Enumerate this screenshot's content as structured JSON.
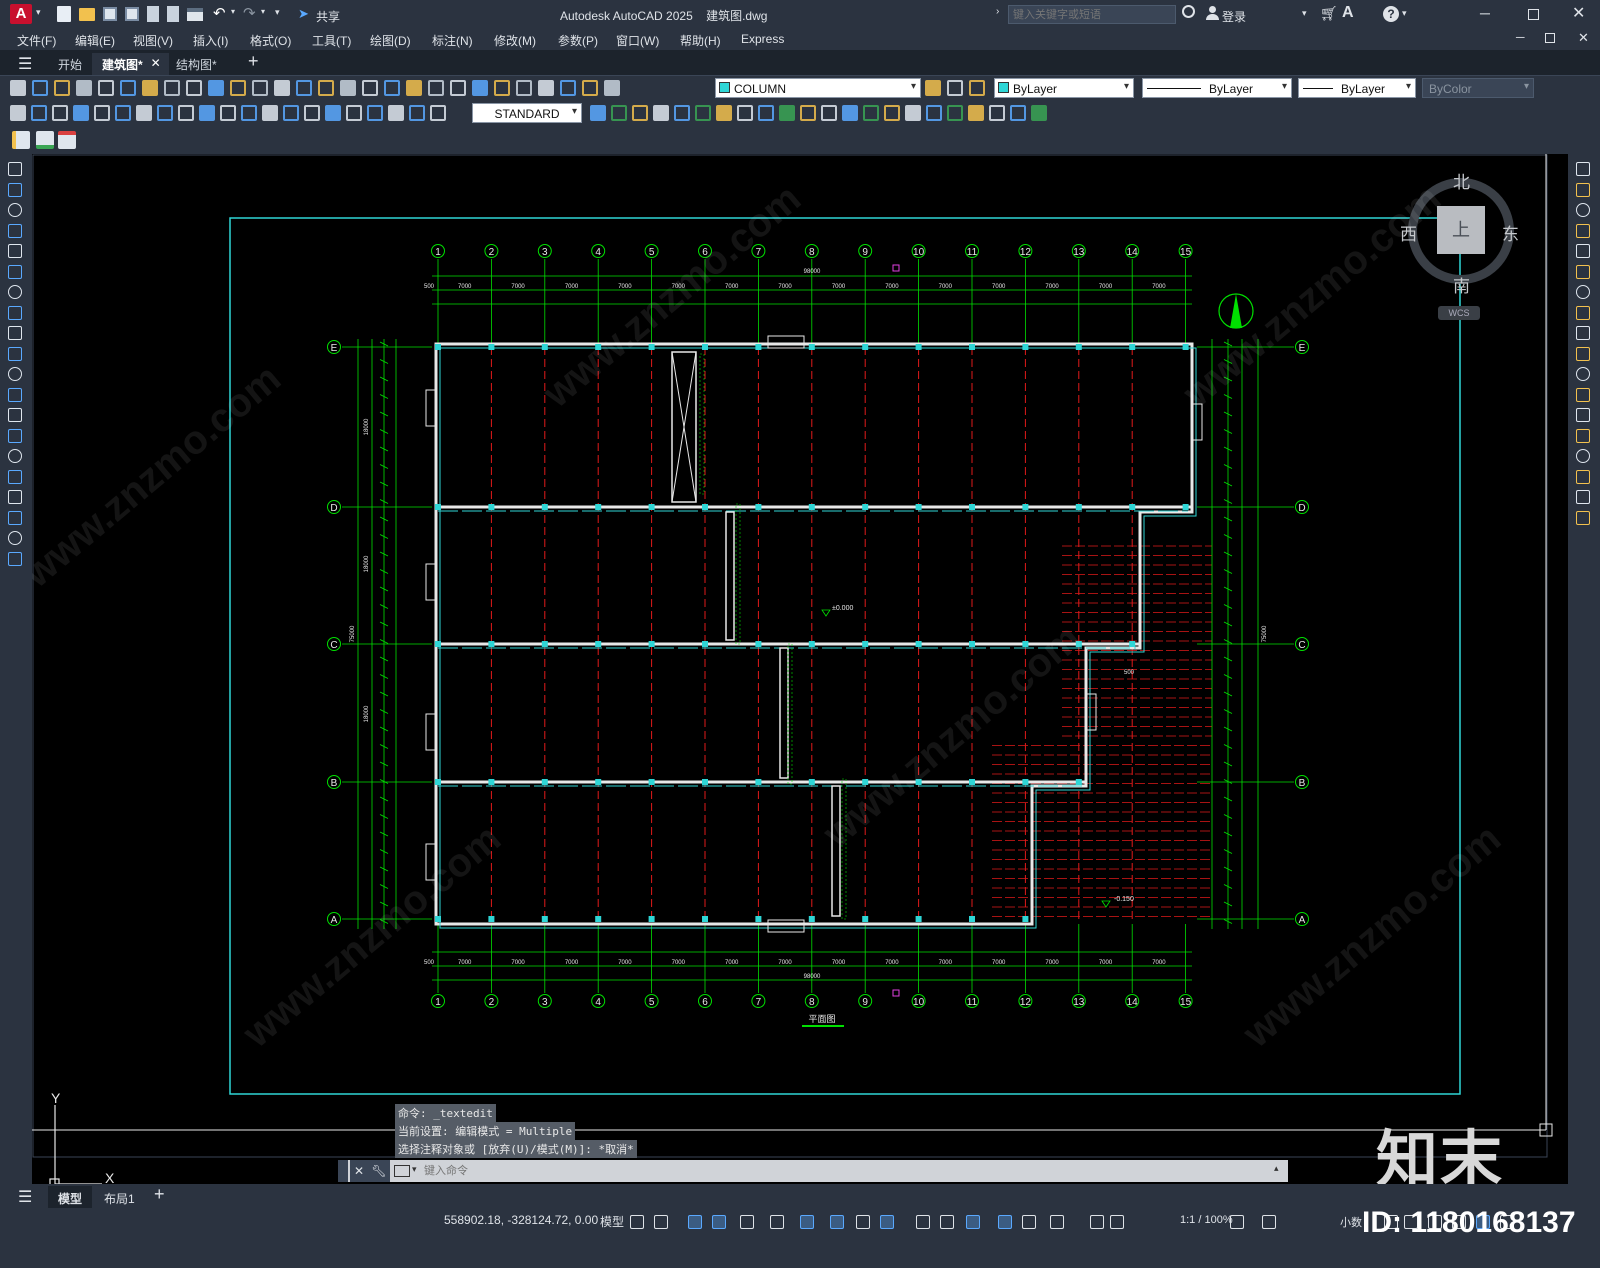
{
  "app": {
    "title": "Autodesk AutoCAD 2025    建筑图.dwg",
    "logo_letter": "A",
    "share_label": "共享",
    "search_placeholder": "键入关键字或短语",
    "login_label": "登录"
  },
  "menu": [
    "文件(F)",
    "编辑(E)",
    "视图(V)",
    "插入(I)",
    "格式(O)",
    "工具(T)",
    "绘图(D)",
    "标注(N)",
    "修改(M)",
    "参数(P)",
    "窗口(W)",
    "帮助(H)",
    "Express"
  ],
  "tabs": [
    {
      "label": "开始",
      "active": false
    },
    {
      "label": "建筑图*",
      "active": true
    },
    {
      "label": "结构图*",
      "active": false
    }
  ],
  "layers": {
    "current_layer": "COLUMN",
    "color": "ByLayer",
    "linetype": "ByLayer",
    "lineweight": "ByLayer",
    "plotstyle": "ByColor",
    "dimstyle": "STANDARD"
  },
  "viewcube": {
    "north": "北",
    "south": "南",
    "east": "东",
    "west": "西",
    "top": "上",
    "wcs": "WCS"
  },
  "drawing": {
    "grid_columns": [
      "1",
      "2",
      "3",
      "4",
      "5",
      "6",
      "7",
      "8",
      "9",
      "10",
      "11",
      "12",
      "13",
      "14",
      "15"
    ],
    "grid_rows": [
      "E",
      "D",
      "C",
      "B",
      "A"
    ],
    "bay_dim": "7000",
    "total_dim": "98000",
    "edge_dim": "500",
    "title": "平面图",
    "elev_1": "±0.000",
    "elev_2": "-0.150",
    "side_dims_left": [
      "18000",
      "18000",
      "18000",
      "75000"
    ],
    "side_dim_500": "500"
  },
  "command": {
    "history": [
      "命令: _textedit",
      "当前设置: 编辑模式 = Multiple",
      "选择注释对象或 [放弃(U)/模式(M)]: *取消*"
    ],
    "placeholder": "键入命令"
  },
  "layout_tabs": [
    "模型",
    "布局1"
  ],
  "status": {
    "coords": "558902.18, -328124.72, 0.00",
    "model": "模型",
    "scale": "1:1 / 100%",
    "units": "小数"
  },
  "watermark": {
    "brand": "知末",
    "id": "ID: 1180168137",
    "site": "www.znzmo.com"
  },
  "colors": {
    "bg_ui": "#2b3340",
    "canvas": "#000000",
    "grid_green": "#00e000",
    "axis_red": "#e01a1a",
    "frame_cyan": "#2fd6d6",
    "wall_white": "#e8e8e8"
  }
}
